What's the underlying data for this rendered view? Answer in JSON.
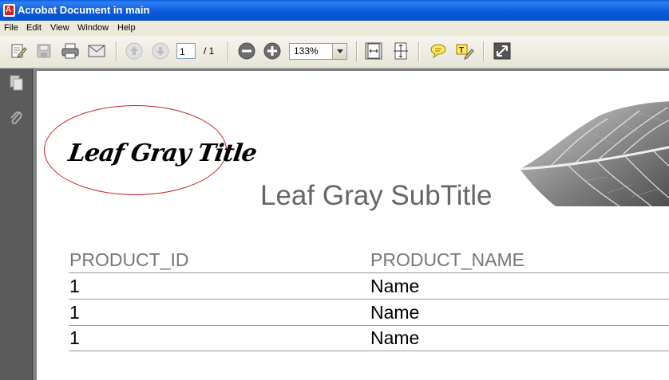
{
  "window": {
    "title": "Acrobat Document in main",
    "app_icon_letter": "A"
  },
  "menu": [
    "File",
    "Edit",
    "View",
    "Window",
    "Help"
  ],
  "toolbar": {
    "page_current": "1",
    "page_total": "/ 1",
    "zoom": "133%"
  },
  "icons": {
    "edit": "edit-document-icon",
    "save": "save-icon",
    "print": "print-icon",
    "email": "email-icon",
    "prev": "previous-page-icon",
    "next": "next-page-icon",
    "zoom_out": "zoom-out-icon",
    "zoom_in": "zoom-in-icon",
    "fit_page": "fit-page-icon",
    "fit_width": "fit-width-icon",
    "comment": "comment-icon",
    "highlight": "highlight-text-icon",
    "fullscreen": "full-screen-icon",
    "pages": "pages-panel-icon",
    "attachments": "attachments-icon"
  },
  "document": {
    "title": "Leaf Gray Title",
    "subtitle": "Leaf Gray SubTitle",
    "columns": [
      "PRODUCT_ID",
      "PRODUCT_NAME"
    ],
    "rows": [
      [
        "1",
        "Name"
      ],
      [
        "1",
        "Name"
      ],
      [
        "1",
        "Name"
      ]
    ]
  },
  "colors": {
    "titlebar": "#0b5bdc",
    "ellipse_border": "#cc2020",
    "header_text": "#777777",
    "subtitle_text": "#666666"
  }
}
